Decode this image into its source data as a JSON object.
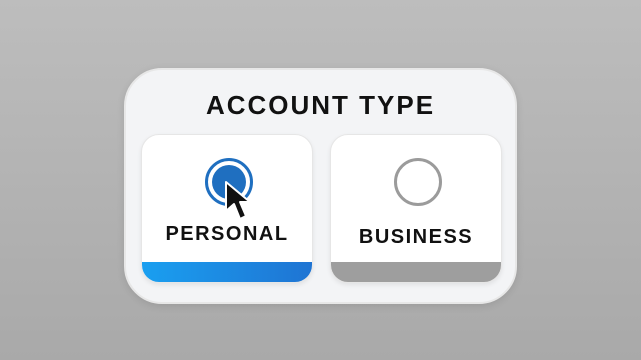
{
  "dialog": {
    "title": "ACCOUNT TYPE"
  },
  "options": [
    {
      "label": "PERSONAL",
      "selected": true,
      "radio_icon": "radio-selected-icon",
      "accent_color": "#1F74D3"
    },
    {
      "label": "BUSINESS",
      "selected": false,
      "radio_icon": "radio-unselected-icon",
      "accent_color": "#9E9E9E"
    }
  ],
  "cursor": {
    "icon": "mouse-pointer-icon"
  }
}
